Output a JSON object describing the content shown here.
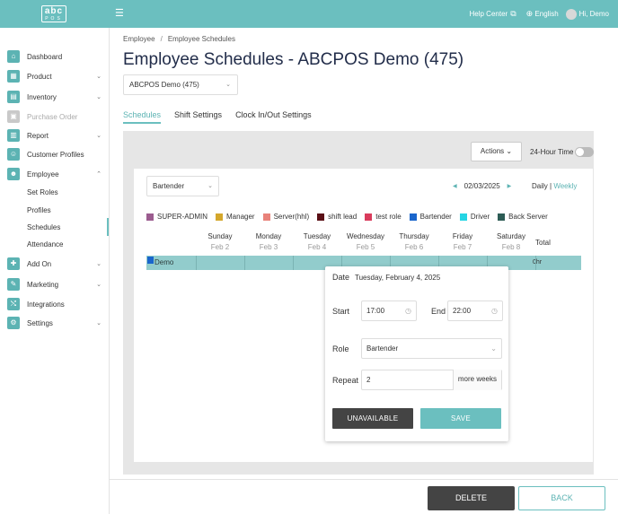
{
  "topbar": {
    "logo_main": "abc",
    "logo_sub": "POS",
    "help": "Help Center",
    "language": "English",
    "greeting": "Hi, Demo"
  },
  "sidebar": {
    "items": [
      {
        "label": "Dashboard",
        "icon": "dashboard-icon"
      },
      {
        "label": "Product",
        "icon": "product-icon"
      },
      {
        "label": "Inventory",
        "icon": "inventory-icon"
      },
      {
        "label": "Purchase Order",
        "icon": "purchase-order-icon"
      },
      {
        "label": "Report",
        "icon": "report-icon"
      },
      {
        "label": "Customer Profiles",
        "icon": "customer-icon"
      },
      {
        "label": "Employee",
        "icon": "employee-icon"
      },
      {
        "label": "Add On",
        "icon": "add-on-icon"
      },
      {
        "label": "Marketing",
        "icon": "marketing-icon"
      },
      {
        "label": "Integrations",
        "icon": "integrations-icon"
      },
      {
        "label": "Settings",
        "icon": "settings-icon"
      }
    ],
    "employee_sub": [
      "Set Roles",
      "Profiles",
      "Schedules",
      "Attendance"
    ]
  },
  "breadcrumb": [
    "Employee",
    "Employee Schedules"
  ],
  "page_title": "Employee Schedules - ABCPOS Demo (475)",
  "store_select": "ABCPOS Demo (475)",
  "tabs": [
    "Schedules",
    "Shift Settings",
    "Clock In/Out Settings"
  ],
  "toolbar": {
    "actions": "Actions",
    "hour_label": "24-Hour Time"
  },
  "schedule": {
    "role_filter": "Bartender",
    "date": "02/03/2025",
    "view_daily": "Daily",
    "view_sep": "|",
    "view_weekly": "Weekly",
    "legend": [
      {
        "label": "SUPER-ADMIN",
        "color": "#9b5c8f"
      },
      {
        "label": "Manager",
        "color": "#d4a72c"
      },
      {
        "label": "Server(hhl)",
        "color": "#e8827a"
      },
      {
        "label": "shift lead",
        "color": "#5a0f16"
      },
      {
        "label": "test role",
        "color": "#d93b5c"
      },
      {
        "label": "Bartender",
        "color": "#1a66cc"
      },
      {
        "label": "Driver",
        "color": "#25d5e4"
      },
      {
        "label": "Back Server",
        "color": "#2d5c55"
      }
    ],
    "days": [
      {
        "name": "Sunday",
        "date": "Feb 2"
      },
      {
        "name": "Monday",
        "date": "Feb 3"
      },
      {
        "name": "Tuesday",
        "date": "Feb 4"
      },
      {
        "name": "Wednesday",
        "date": "Feb 5"
      },
      {
        "name": "Thursday",
        "date": "Feb 6"
      },
      {
        "name": "Friday",
        "date": "Feb 7"
      },
      {
        "name": "Saturday",
        "date": "Feb 8"
      }
    ],
    "total_header": "Total",
    "employee": "Demo",
    "employee_total": "0hr"
  },
  "popup": {
    "date_label": "Date",
    "date_value": "Tuesday, February 4, 2025",
    "start_label": "Start",
    "start_value": "17:00",
    "end_label": "End",
    "end_value": "22:00",
    "role_label": "Role",
    "role_value": "Bartender",
    "repeat_label": "Repeat",
    "repeat_value": "2",
    "repeat_suffix": "more weeks",
    "unavailable": "UNAVAILABLE",
    "save": "SAVE"
  },
  "footer": {
    "delete": "DELETE",
    "back": "BACK"
  }
}
